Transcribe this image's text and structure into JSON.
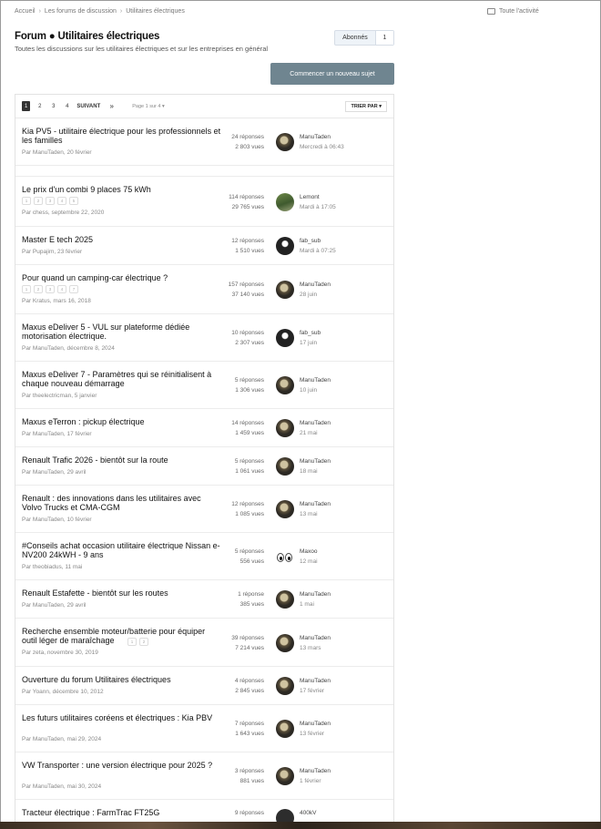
{
  "breadcrumb": [
    "Accueil",
    "Les forums de discussion",
    "Utilitaires électriques"
  ],
  "activity_label": "Toute l'activité",
  "page_title": "Forum ● Utilitaires électriques",
  "page_subtitle": "Toutes les discussions sur les utilitaires électriques et sur les entreprises en général",
  "follow": {
    "label": "Abonnés",
    "count": "1"
  },
  "new_topic_label": "Commencer un nouveau sujet",
  "pagination": {
    "pages": [
      "1",
      "2",
      "3",
      "4"
    ],
    "next": "SUIVANT",
    "last": "»",
    "jump": "Page 1 sur 4"
  },
  "sort_label": "TRIER PAR",
  "topics": [
    {
      "title": "Kia PV5 - utilitaire électrique pour les professionnels et les familles",
      "by": "Par ManuTaden, 20 février",
      "replies": "24 réponses",
      "views": "2 803 vues",
      "last_user": "ManuTaden",
      "last_date": "Mercredi à 06:43",
      "avatar": "manu",
      "mini": []
    },
    {
      "title": "Le prix d'un combi 9 places 75 kWh",
      "by": "Par chess, septembre 22, 2020",
      "replies": "114 réponses",
      "views": "29 765 vues",
      "last_user": "Lemont",
      "last_date": "Mardi à 17:05",
      "avatar": "lemont",
      "mini": [
        "1",
        "2",
        "3",
        "4",
        "5"
      ]
    },
    {
      "title": "Master E tech 2025",
      "by": "Par Pupajim, 23 février",
      "replies": "12 réponses",
      "views": "1 510 vues",
      "last_user": "fab_sub",
      "last_date": "Mardi à 07:25",
      "avatar": "fab",
      "mini": []
    },
    {
      "title": "Pour quand un camping-car électrique ?",
      "by": "Par Kratus, mars 16, 2018",
      "replies": "157 réponses",
      "views": "37 140 vues",
      "last_user": "ManuTaden",
      "last_date": "28 juin",
      "avatar": "manu",
      "mini": [
        "1",
        "2",
        "3",
        "4",
        "7"
      ]
    },
    {
      "title": "Maxus eDeliver 5 - VUL sur plateforme dédiée motorisation électrique.",
      "by": "Par ManuTaden, décembre 8, 2024",
      "replies": "10 réponses",
      "views": "2 307 vues",
      "last_user": "fab_sub",
      "last_date": "17 juin",
      "avatar": "fab",
      "mini": []
    },
    {
      "title": "Maxus eDeliver 7 - Paramètres qui se réinitialisent à chaque nouveau démarrage",
      "by": "Par theelectricman, 5 janvier",
      "replies": "5 réponses",
      "views": "1 306 vues",
      "last_user": "ManuTaden",
      "last_date": "10 juin",
      "avatar": "manu",
      "mini": []
    },
    {
      "title": "Maxus eTerron : pickup électrique",
      "by": "Par ManuTaden, 17 février",
      "replies": "14 réponses",
      "views": "1 459 vues",
      "last_user": "ManuTaden",
      "last_date": "21 mai",
      "avatar": "manu",
      "mini": []
    },
    {
      "title": "Renault Trafic 2026 - bientôt sur la route",
      "by": "Par ManuTaden, 29 avril",
      "replies": "5 réponses",
      "views": "1 061 vues",
      "last_user": "ManuTaden",
      "last_date": "18 mai",
      "avatar": "manu",
      "mini": []
    },
    {
      "title": "Renault : des innovations dans les utilitaires avec Volvo Trucks et CMA-CGM",
      "by": "Par ManuTaden, 10 février",
      "replies": "12 réponses",
      "views": "1 085 vues",
      "last_user": "ManuTaden",
      "last_date": "13 mai",
      "avatar": "manu",
      "mini": []
    },
    {
      "title": "#Conseils achat occasion utilitaire électrique Nissan e-NV200 24kWH - 9 ans",
      "by": "Par theobiadus, 11 mai",
      "replies": "5 réponses",
      "views": "556 vues",
      "last_user": "Maxoo",
      "last_date": "12 mai",
      "avatar": "maxoo",
      "mini": []
    },
    {
      "title": "Renault Estafette - bientôt sur les routes",
      "by": "Par ManuTaden, 29 avril",
      "replies": "1 réponse",
      "views": "385 vues",
      "last_user": "ManuTaden",
      "last_date": "1 mai",
      "avatar": "manu",
      "mini": []
    },
    {
      "title": "Recherche ensemble moteur/batterie pour équiper outil léger de maraîchage",
      "by": "Par zeta, novembre 30, 2019",
      "replies": "39 réponses",
      "views": "7 214 vues",
      "last_user": "ManuTaden",
      "last_date": "13 mars",
      "avatar": "manu",
      "mini": [
        "1",
        "2"
      ]
    },
    {
      "title": "Ouverture du forum Utilitaires électriques",
      "by": "Par Yoann, décembre 10, 2012",
      "replies": "4 réponses",
      "views": "2 845 vues",
      "last_user": "ManuTaden",
      "last_date": "17 février",
      "avatar": "manu",
      "mini": []
    },
    {
      "title": "Les futurs utilitaires coréens et électriques : Kia PBV",
      "by": "Par ManuTaden, mai 29, 2024",
      "replies": "7 réponses",
      "views": "1 643 vues",
      "last_user": "ManuTaden",
      "last_date": "13 février",
      "avatar": "manu",
      "mini": []
    },
    {
      "title": "VW Transporter : une version électrique pour 2025 ?",
      "by": "Par ManuTaden, mai 30, 2024",
      "replies": "3 réponses",
      "views": "881 vues",
      "last_user": "ManuTaden",
      "last_date": "1 février",
      "avatar": "manu",
      "mini": []
    },
    {
      "title": "Tracteur électrique : FarmTrac FT25G",
      "by": "",
      "replies": "9 réponses",
      "views": "",
      "last_user": "400kV",
      "last_date": "",
      "avatar": "kv",
      "mini": []
    }
  ]
}
